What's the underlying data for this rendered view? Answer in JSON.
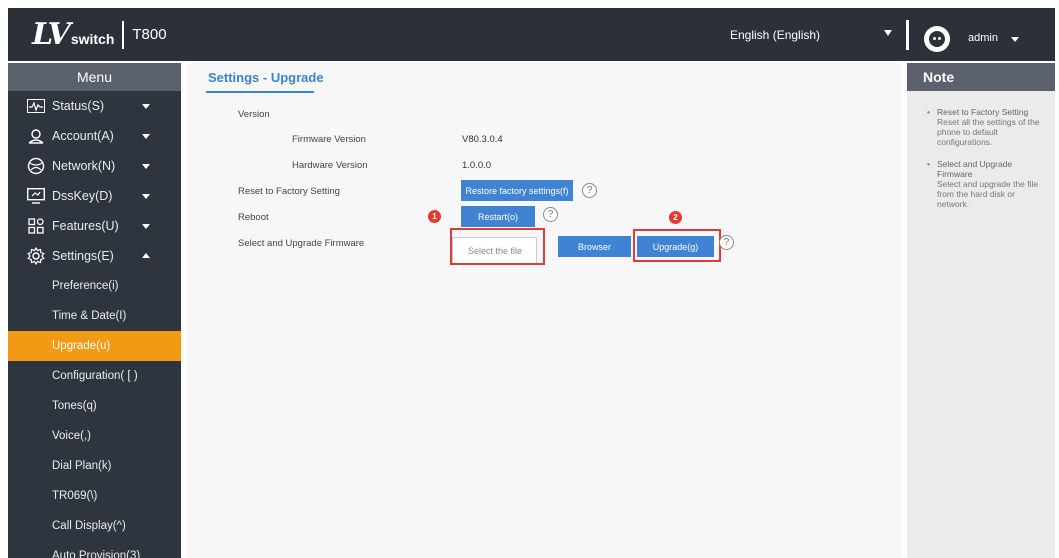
{
  "header": {
    "logo_mark": "LV",
    "logo_text": "switch",
    "model": "T800",
    "language": "English (English)",
    "user": "admin"
  },
  "sidebar": {
    "title": "Menu",
    "items": [
      {
        "label": "Status(S)",
        "icon": "status-icon",
        "expanded": false
      },
      {
        "label": "Account(A)",
        "icon": "account-icon",
        "expanded": false
      },
      {
        "label": "Network(N)",
        "icon": "network-icon",
        "expanded": false
      },
      {
        "label": "DssKey(D)",
        "icon": "dsskey-icon",
        "expanded": false
      },
      {
        "label": "Features(U)",
        "icon": "features-icon",
        "expanded": false
      },
      {
        "label": "Settings(E)",
        "icon": "settings-icon",
        "expanded": true
      }
    ],
    "sub_items": [
      {
        "label": "Preference(i)",
        "active": false
      },
      {
        "label": "Time & Date(I)",
        "active": false
      },
      {
        "label": "Upgrade(u)",
        "active": true
      },
      {
        "label": "Configuration( [ )",
        "active": false
      },
      {
        "label": "Tones(q)",
        "active": false
      },
      {
        "label": "Voice(,)",
        "active": false
      },
      {
        "label": "Dial Plan(k)",
        "active": false
      },
      {
        "label": "TR069(\\)",
        "active": false
      },
      {
        "label": "Call Display(^)",
        "active": false
      },
      {
        "label": "Auto Provision(3)",
        "active": false
      }
    ]
  },
  "main": {
    "title": "Settings - Upgrade",
    "version_label": "Version",
    "firmware_label": "Firmware Version",
    "firmware_value": "V80.3.0.4",
    "hardware_label": "Hardware Version",
    "hardware_value": "1.0.0.0",
    "reset_label": "Reset to Factory Setting",
    "reset_button": "Restore factory settings(f)",
    "reboot_label": "Reboot",
    "restart_button": "Restart(o)",
    "upgrade_label": "Select and Upgrade Firmware",
    "file_placeholder": "Select the file",
    "browse_button": "Browser",
    "upgrade_button": "Upgrade(g)",
    "help_glyph": "?",
    "step1": "1",
    "step2": "2"
  },
  "note": {
    "title": "Note",
    "entries": [
      {
        "head": "Reset to Factory Setting",
        "body": "Reset all the settings of the phone to default configurations."
      },
      {
        "head": "Select and Upgrade Firmware",
        "body": "Select and upgrade the file from the hard disk or network."
      }
    ]
  },
  "colors": {
    "header_bg": "#2b3039",
    "sidebar_bg": "#2f353f",
    "menu_title_bg": "#5a616c",
    "active_item": "#f39a15",
    "button": "#3f83d2",
    "accent_title": "#3b84c9",
    "highlight": "#e03b3b"
  }
}
